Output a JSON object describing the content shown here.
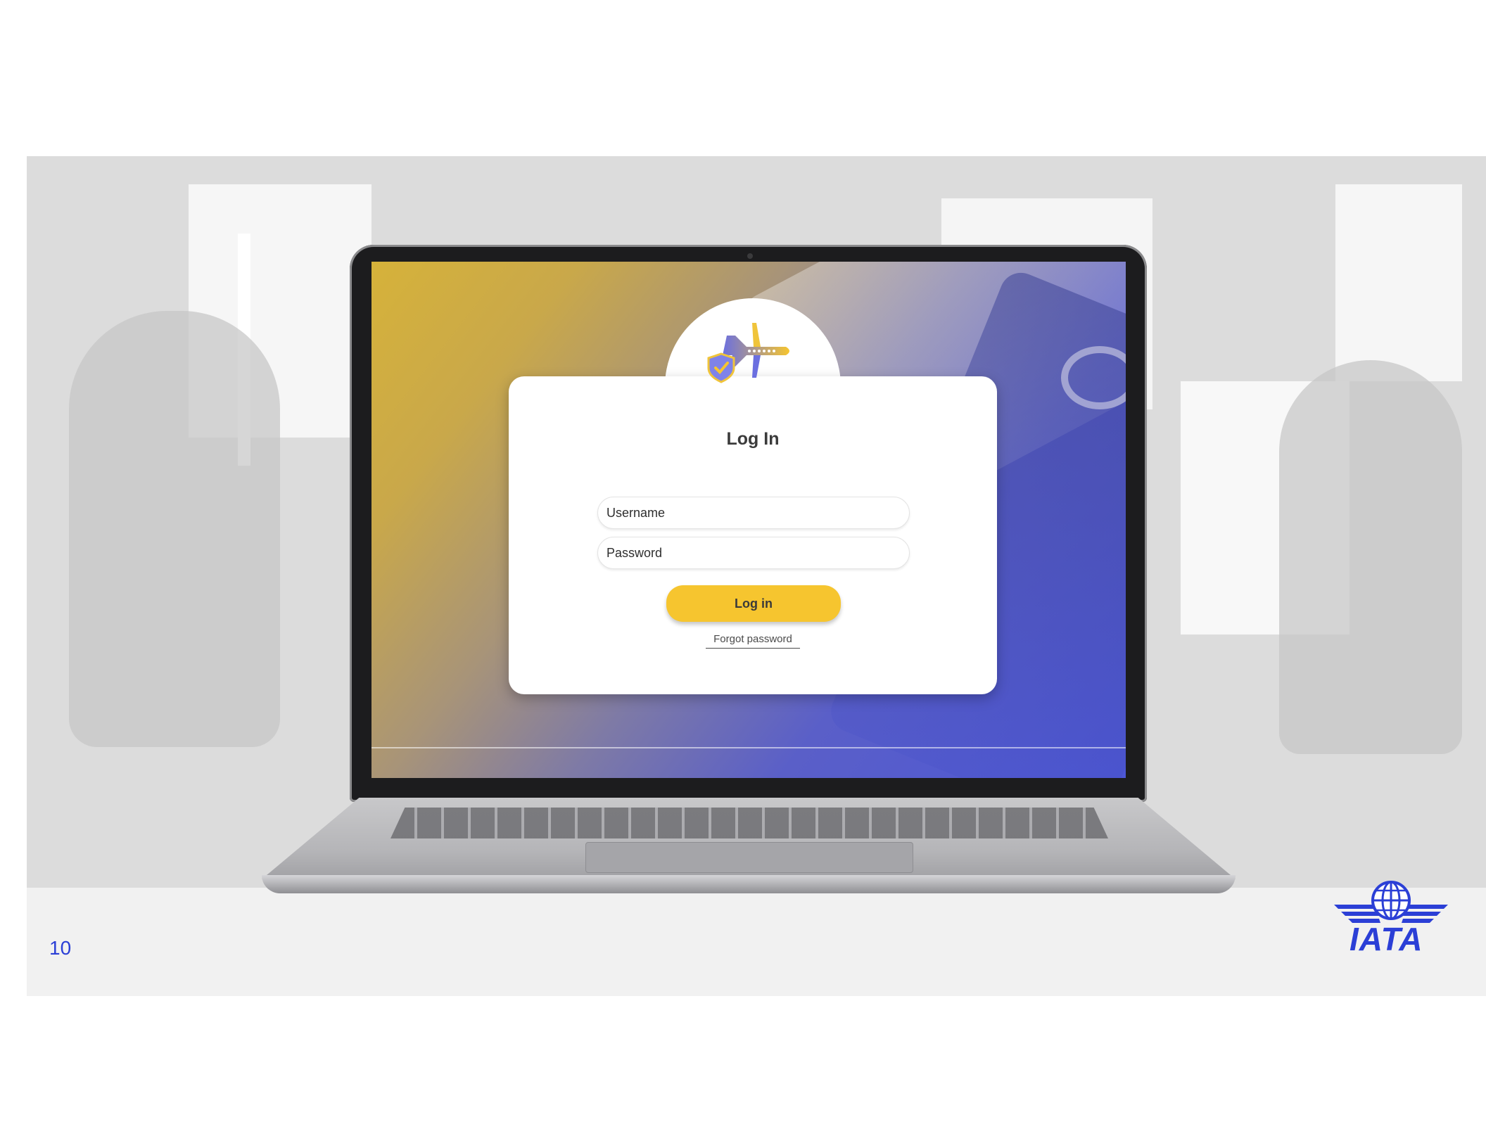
{
  "login_card": {
    "title": "Log In",
    "username_placeholder": "Username",
    "password_placeholder": "Password",
    "login_button_label": "Log in",
    "forgot_password_label": "Forgot password"
  },
  "slide": {
    "page_number": "10",
    "brand": "IATA"
  },
  "icons": {
    "app_logo": "airplane-shield-icon",
    "brand_logo": "iata-globe-wings-icon"
  },
  "colors": {
    "accent_yellow": "#f6c52f",
    "brand_blue": "#2b3fd6",
    "gradient_start": "#d6b23a",
    "gradient_end": "#4d57d6"
  }
}
